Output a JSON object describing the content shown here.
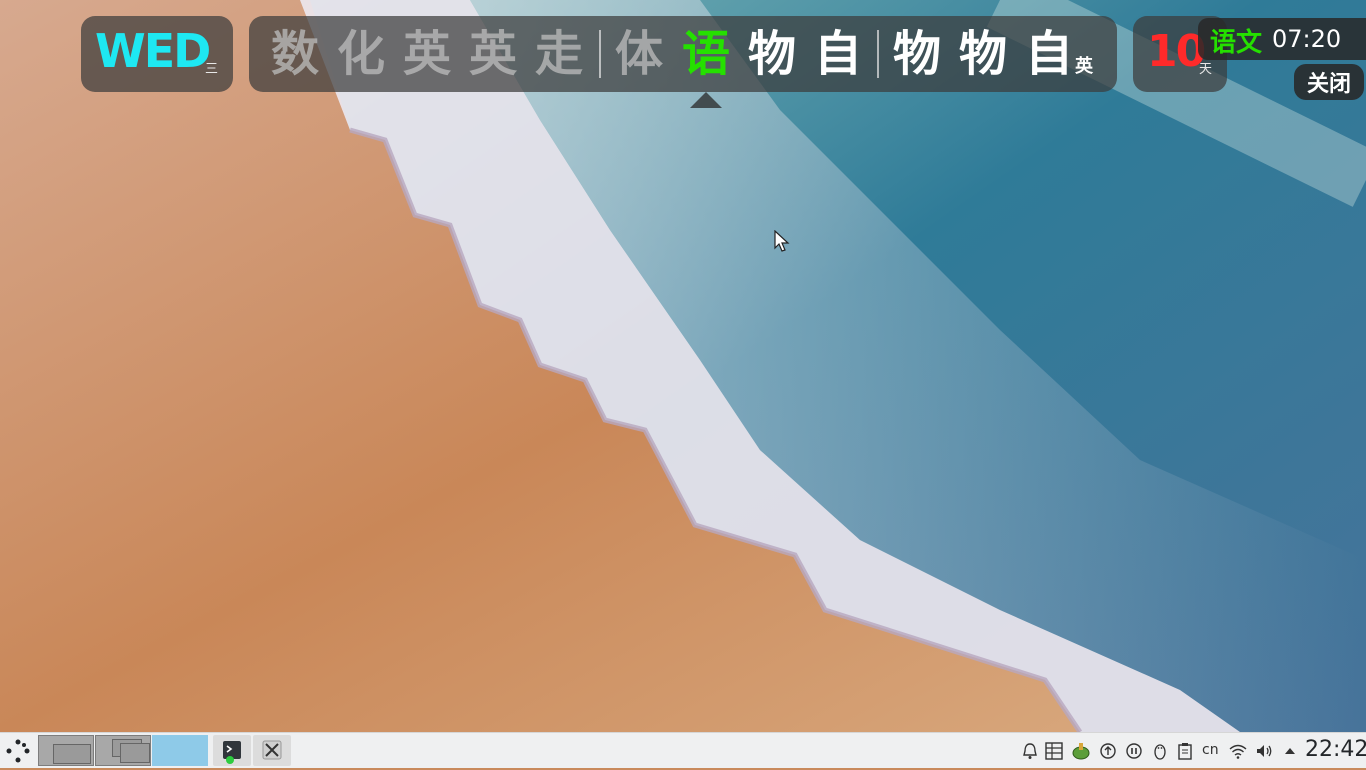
{
  "weekday": {
    "abbr": "WED",
    "cn": "三"
  },
  "schedule": {
    "courses": [
      {
        "label": "数",
        "state": "past"
      },
      {
        "label": "化",
        "state": "past"
      },
      {
        "label": "英",
        "state": "past"
      },
      {
        "label": "英",
        "state": "past"
      },
      {
        "label": "走",
        "state": "past"
      },
      {
        "label": "体",
        "state": "past"
      },
      {
        "label": "语",
        "state": "current"
      },
      {
        "label": "物",
        "state": "future"
      },
      {
        "label": "自",
        "state": "future"
      },
      {
        "label": "物",
        "state": "future"
      },
      {
        "label": "物",
        "state": "future"
      },
      {
        "label": "自",
        "state": "future"
      }
    ],
    "tail": "英"
  },
  "countdown": {
    "number": "10",
    "unit": "天"
  },
  "next_class": {
    "subject": "语文",
    "time": "07:20"
  },
  "close_label": "关闭",
  "taskbar": {
    "input_method": "cn",
    "clock": "22:42",
    "tray_icons": [
      "bell-icon",
      "table-icon",
      "turtle-icon",
      "update-icon",
      "pause-icon",
      "tux-icon",
      "clipboard-icon",
      "wifi-icon",
      "volume-icon",
      "arrow-up-icon"
    ]
  },
  "colors": {
    "past": "#bebebe",
    "current": "#25e000",
    "future": "#ffffff",
    "weekday": "#1ee8f2",
    "countdown": "#ff2a2a"
  }
}
